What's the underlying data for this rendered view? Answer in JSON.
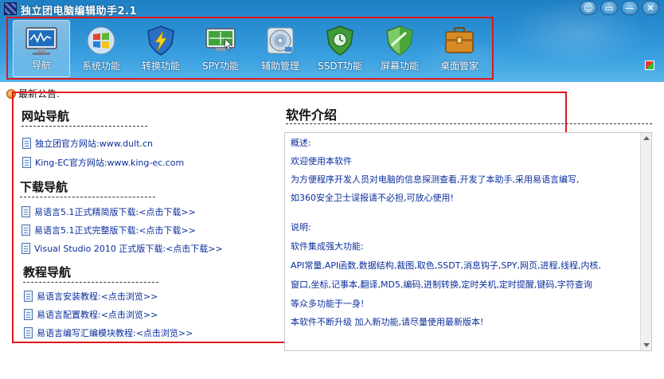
{
  "window": {
    "title": "独立团电脑编辑助手2.1",
    "buttons": [
      "☺",
      "▭",
      "—",
      "✕"
    ]
  },
  "toolbar": {
    "items": [
      {
        "label": "导航",
        "icon": "monitor-icon"
      },
      {
        "label": "系统功能",
        "icon": "windows-logo-icon"
      },
      {
        "label": "转换功能",
        "icon": "shield-lightning-icon"
      },
      {
        "label": "SPY功能",
        "icon": "screen-target-icon"
      },
      {
        "label": "辅助管理",
        "icon": "disc-icon"
      },
      {
        "label": "SSDT功能",
        "icon": "shield-clock-icon"
      },
      {
        "label": "屏幕功能",
        "icon": "shield-green-icon"
      },
      {
        "label": "桌面管家",
        "icon": "briefcase-icon"
      }
    ]
  },
  "notice": {
    "label": "最新公告:"
  },
  "site_nav": {
    "title": "网站导航",
    "links": [
      "独立团官方网站:www.dult.cn",
      "King-EC官方网站:www.king-ec.com"
    ]
  },
  "download_nav": {
    "title": "下载导航",
    "links": [
      "易语言5.1正式精简版下载:<点击下载>>",
      "易语言5.1正式完整版下载:<点击下载>>",
      "Visual Studio 2010 正式版下载:<点击下载>>"
    ]
  },
  "tutorial_nav": {
    "title": "教程导航",
    "links": [
      "易语言安装教程:<点击浏览>>",
      "易语言配置教程:<点击浏览>>",
      "易语言编写汇编模块教程:<点击浏览>>"
    ]
  },
  "intro": {
    "title": "软件介绍",
    "lines": [
      "概述:",
      "欢迎使用本软件",
      "为方便程序开发人员对电脑的信息探测查看,开发了本助手,采用易语言编写,",
      "如360安全卫士误报请不必担,可放心使用!",
      "",
      "说明:",
      "软件集成强大功能:",
      "API常量,API函数,数据结构,裁图,取色,SSDT,消息钩子,SPY,网页,进程,线程,内核,",
      "窗口,坐标,记事本,翻译,MD5,编码,进制转换,定时关机,定时提醒,键码,字符查询",
      "等众多功能于一身!",
      "本软件不断升级 加入新功能,请尽量使用最新版本!"
    ]
  },
  "colors": {
    "header_blue": "#2a8ed2",
    "highlight_red": "#e0161b",
    "link_blue": "#0b2e9c"
  }
}
